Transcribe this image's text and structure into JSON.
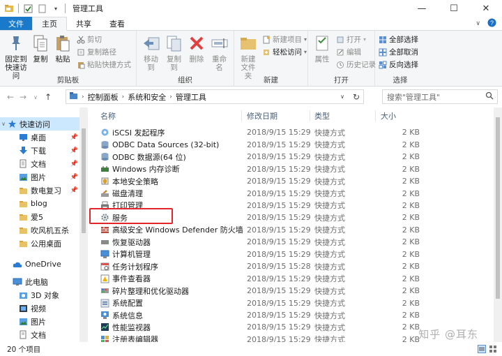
{
  "window": {
    "title": "管理工具",
    "minimize": "—",
    "maximize": "☐",
    "close": "✕"
  },
  "tabs": {
    "file": "文件",
    "home": "主页",
    "share": "共享",
    "view": "查看"
  },
  "ribbon": {
    "clipboard": {
      "label": "剪贴板",
      "pin": "固定到\n快速访问",
      "copy": "复制",
      "paste": "粘贴",
      "cut": "剪切",
      "copy_path": "复制路径",
      "paste_shortcut": "粘贴快捷方式"
    },
    "organize": {
      "label": "组织",
      "move_to": "移动到",
      "copy_to": "复制到",
      "delete": "删除",
      "rename": "重命名"
    },
    "new": {
      "label": "新建",
      "new_folder": "新建\n文件夹",
      "new_item": "新建项目",
      "easy_access": "轻松访问"
    },
    "open": {
      "label": "打开",
      "properties": "属性",
      "open": "打开",
      "edit": "编辑",
      "history": "历史记录"
    },
    "select": {
      "label": "选择",
      "select_all": "全部选择",
      "select_none": "全部取消",
      "invert": "反向选择"
    }
  },
  "address": {
    "segments": [
      "控制面板",
      "系统和安全",
      "管理工具"
    ],
    "search_placeholder": "搜索\"管理工具\""
  },
  "nav": {
    "quick_access": "快速访问",
    "items": [
      {
        "label": "桌面",
        "icon": "desktop-icon",
        "pinned": true
      },
      {
        "label": "下载",
        "icon": "download-icon",
        "pinned": true
      },
      {
        "label": "文档",
        "icon": "document-icon",
        "pinned": true
      },
      {
        "label": "图片",
        "icon": "picture-icon",
        "pinned": true
      },
      {
        "label": "数电复习",
        "icon": "folder-icon",
        "pinned": true
      },
      {
        "label": "blog",
        "icon": "folder-icon",
        "pinned": false
      },
      {
        "label": "爱5",
        "icon": "folder-icon",
        "pinned": false
      },
      {
        "label": "吹风机五杀",
        "icon": "folder-icon",
        "pinned": false
      },
      {
        "label": "公用桌面",
        "icon": "folder-icon",
        "pinned": false
      }
    ],
    "onedrive": "OneDrive",
    "this_pc": "此电脑",
    "pc_items": [
      {
        "label": "3D 对象",
        "icon": "3d-objects-icon"
      },
      {
        "label": "视频",
        "icon": "video-icon"
      },
      {
        "label": "图片",
        "icon": "picture-icon"
      },
      {
        "label": "文档",
        "icon": "document-icon"
      }
    ]
  },
  "columns": {
    "name": "名称",
    "date": "修改日期",
    "type": "类型",
    "size": "大小"
  },
  "files": [
    {
      "name": "iSCSI 发起程序",
      "date": "2018/9/15 15:29",
      "type": "快捷方式",
      "size": "2 KB",
      "icon": "iscsi-icon"
    },
    {
      "name": "ODBC Data Sources (32-bit)",
      "date": "2018/9/15 15:29",
      "type": "快捷方式",
      "size": "2 KB",
      "icon": "odbc-icon"
    },
    {
      "name": "ODBC 数据源(64 位)",
      "date": "2018/9/15 15:29",
      "type": "快捷方式",
      "size": "2 KB",
      "icon": "odbc-icon"
    },
    {
      "name": "Windows 内存诊断",
      "date": "2018/9/15 15:29",
      "type": "快捷方式",
      "size": "2 KB",
      "icon": "memory-diagnostic-icon"
    },
    {
      "name": "本地安全策略",
      "date": "2018/9/15 15:29",
      "type": "快捷方式",
      "size": "2 KB",
      "icon": "security-policy-icon"
    },
    {
      "name": "磁盘清理",
      "date": "2018/9/15 15:29",
      "type": "快捷方式",
      "size": "2 KB",
      "icon": "disk-cleanup-icon"
    },
    {
      "name": "打印管理",
      "date": "2018/9/15 15:29",
      "type": "快捷方式",
      "size": "2 KB",
      "icon": "printer-icon"
    },
    {
      "name": "服务",
      "date": "2018/9/15 15:29",
      "type": "快捷方式",
      "size": "2 KB",
      "icon": "services-gear-icon"
    },
    {
      "name": "高级安全 Windows Defender 防火墙",
      "date": "2018/9/15 15:29",
      "type": "快捷方式",
      "size": "2 KB",
      "icon": "firewall-icon"
    },
    {
      "name": "恢复驱动器",
      "date": "2018/9/15 15:29",
      "type": "快捷方式",
      "size": "2 KB",
      "icon": "recovery-drive-icon"
    },
    {
      "name": "计算机管理",
      "date": "2018/9/15 15:29",
      "type": "快捷方式",
      "size": "2 KB",
      "icon": "computer-management-icon"
    },
    {
      "name": "任务计划程序",
      "date": "2018/9/15 15:28",
      "type": "快捷方式",
      "size": "2 KB",
      "icon": "task-scheduler-icon"
    },
    {
      "name": "事件查看器",
      "date": "2018/9/15 15:29",
      "type": "快捷方式",
      "size": "2 KB",
      "icon": "event-viewer-icon"
    },
    {
      "name": "碎片整理和优化驱动器",
      "date": "2018/9/15 15:29",
      "type": "快捷方式",
      "size": "2 KB",
      "icon": "defrag-icon"
    },
    {
      "name": "系统配置",
      "date": "2018/9/15 15:29",
      "type": "快捷方式",
      "size": "2 KB",
      "icon": "system-config-icon"
    },
    {
      "name": "系统信息",
      "date": "2018/9/15 15:29",
      "type": "快捷方式",
      "size": "2 KB",
      "icon": "system-info-icon"
    },
    {
      "name": "性能监视器",
      "date": "2018/9/15 15:29",
      "type": "快捷方式",
      "size": "2 KB",
      "icon": "performance-monitor-icon"
    },
    {
      "name": "注册表编辑器",
      "date": "2018/9/15 15:29",
      "type": "快捷方式",
      "size": "2 KB",
      "icon": "registry-editor-icon"
    }
  ],
  "status": {
    "count": "20 个项目"
  },
  "watermark": "知乎 @耳东",
  "colors": {
    "file_tab": "#1979ca",
    "selection": "#cce8ff",
    "highlight_box": "#e3252b"
  }
}
